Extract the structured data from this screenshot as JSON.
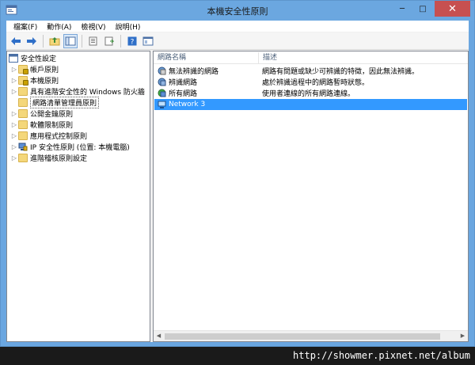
{
  "window": {
    "title": "本機安全性原則",
    "minimize": "─",
    "maximize": "□",
    "close": "✕"
  },
  "menu": [
    "檔案(F)",
    "動作(A)",
    "檢視(V)",
    "說明(H)"
  ],
  "toolbar": {
    "buttons": [
      "back-icon",
      "forward-icon",
      "up-folder-icon",
      "show-hide-tree-icon",
      "export-list-icon",
      "properties-icon",
      "help-icon",
      "console-icon"
    ]
  },
  "tree": {
    "root": "安全性設定",
    "items": [
      {
        "label": "帳戶原則",
        "icon": "lock-folder"
      },
      {
        "label": "本機原則",
        "icon": "lock-folder"
      },
      {
        "label": "具有進階安全性的 Windows 防火牆",
        "icon": "folder"
      },
      {
        "label": "網路清單管理員原則",
        "icon": "folder"
      },
      {
        "label": "公開金鑰原則",
        "icon": "folder"
      },
      {
        "label": "軟體限制原則",
        "icon": "folder"
      },
      {
        "label": "應用程式控制原則",
        "icon": "folder"
      },
      {
        "label": "IP 安全性原則 (位置: 本機電腦)",
        "icon": "ipsec"
      },
      {
        "label": "進階稽核原則設定",
        "icon": "folder"
      }
    ]
  },
  "list": {
    "headers": [
      "網路名稱",
      "描述"
    ],
    "rows": [
      {
        "name": "無法辨識的網路",
        "desc": "網路有問題或缺少可辨識的特徵，因此無法辨識。"
      },
      {
        "name": "辨識網路",
        "desc": "處於辨識過程中的網路暫時狀態。"
      },
      {
        "name": "所有網路",
        "desc": "使用者連線的所有網路連線。"
      },
      {
        "name": "Network 3",
        "desc": ""
      }
    ]
  },
  "watermark": "http://showmer.pixnet.net/album",
  "colors": {
    "titlebar": "#6ba7e0",
    "selection": "#3399ff",
    "close_button": "#c75050"
  }
}
